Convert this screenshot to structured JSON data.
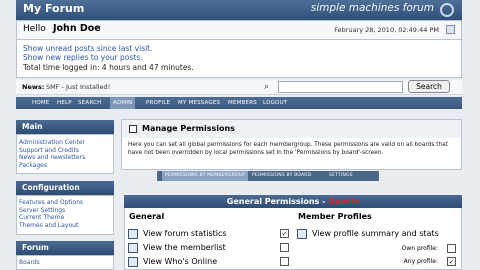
{
  "header": {
    "forum_title": "My Forum",
    "brand": "simple machines forum"
  },
  "user": {
    "hello": "Hello",
    "name": "John Doe",
    "date_time": "February 28, 2010, 02:49:44 PM",
    "unread_link": "Show unread posts since last visit.",
    "replies_link": "Show new replies to your posts.",
    "time_logged": "Total time logged in: 4 hours and 47 minutes."
  },
  "news": {
    "label": "News:",
    "text": "SMF - Just Installed!"
  },
  "search": {
    "value": "",
    "button": "Search"
  },
  "nav": {
    "items": [
      "HOME",
      "HELP",
      "SEARCH",
      "ADMIN",
      "PROFILE",
      "MY MESSAGES",
      "MEMBERS",
      "LOGOUT"
    ],
    "active": "ADMIN"
  },
  "sidebar": {
    "main_title": "Main",
    "main_items": [
      "Administration Center",
      "Support and Credits",
      "News and newsletters",
      "Packages"
    ],
    "config_title": "Configuration",
    "config_items": [
      "Features and Options",
      "Server Settings",
      "Current Theme",
      "Themes and Layout"
    ],
    "forum_title": "Forum",
    "forum_items": [
      "Boards"
    ]
  },
  "permissions": {
    "title": "Manage Permissions",
    "description": "Here you can set all global permissions for each membergroup. These permissions are valid on all boards that have not been overridden by local permissions set in the 'Permissions by board'-screen.",
    "tabs": [
      "PERMISSIONS BY MEMBERGROUP",
      "PERMISSIONS BY BOARD",
      "SETTINGS"
    ],
    "group_header": "General Permissions - ",
    "group_name": "Guests",
    "col_general": "General",
    "col_member": "Member Profiles",
    "general_rows": [
      "View forum statistics",
      "View the memberlist",
      "View Who's Online"
    ],
    "general_checked": [
      true,
      false,
      false
    ],
    "member_row": "View profile summary and stats",
    "member_checked": true,
    "own_profile": "Own profile:",
    "own_checked": false,
    "any_profile": "Any profile:",
    "any_checked": true
  }
}
